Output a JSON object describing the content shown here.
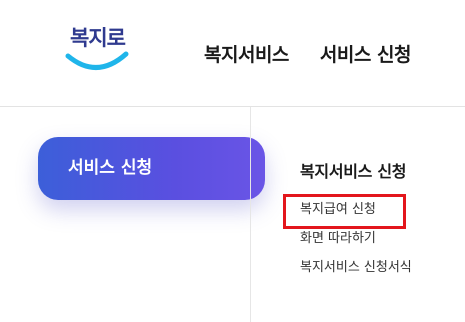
{
  "logo": {
    "text": "복지로",
    "accent_color": "#1fb5ea"
  },
  "topnav": {
    "items": [
      {
        "label": "복지서비스"
      },
      {
        "label": "서비스 신청"
      }
    ]
  },
  "sidebar": {
    "active_label": "서비스 신청"
  },
  "submenu": {
    "title": "복지서비스 신청",
    "items": [
      {
        "label": "복지급여 신청",
        "highlighted": true
      },
      {
        "label": "화면 따라하기"
      },
      {
        "label": "복지서비스 신청서식"
      }
    ]
  },
  "colors": {
    "highlight_border": "#e3161c",
    "active_gradient_start": "#3c5fd9",
    "active_gradient_end": "#6a55e6"
  }
}
